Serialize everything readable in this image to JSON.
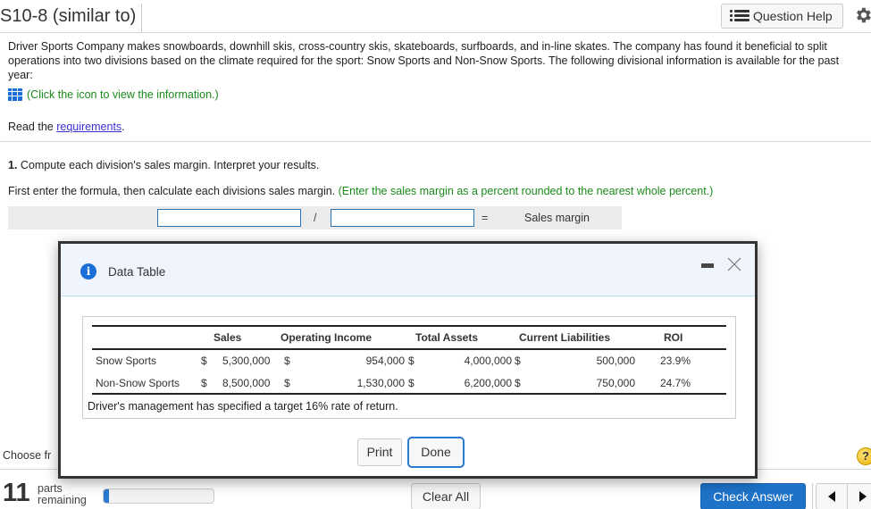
{
  "header": {
    "title": "S10-8 (similar to)",
    "question_help_label": "Question Help"
  },
  "problem": {
    "intro": "Driver Sports Company makes snowboards, downhill skis, cross-country skis, skateboards, surfboards, and in-line skates. The company has found it beneficial to split operations into two divisions based on the climate required for the sport: Snow Sports and Non-Snow Sports. The following divisional information is available for the past year:",
    "info_link": "(Click the icon to view the information.)",
    "read_prefix": "Read the ",
    "requirements_link": "requirements",
    "read_suffix": "."
  },
  "question": {
    "number": "1.",
    "text": " Compute each division's sales margin. Interpret your results.",
    "instruction": "First enter the formula, then calculate each divisions sales margin. ",
    "instruction_hint": "(Enter the sales margin as a percent rounded to the nearest whole percent.)",
    "formula": {
      "input1_value": "",
      "operator": "/",
      "input2_value": "",
      "equals": "=",
      "result_label": "Sales margin"
    },
    "choose_text": "Choose fr"
  },
  "modal": {
    "title": "Data Table",
    "table": {
      "headers": [
        "",
        "Sales",
        "Operating Income",
        "Total Assets",
        "Current Liabilities",
        "ROI"
      ],
      "rows": [
        {
          "division": "Snow Sports",
          "sales_cur": "$",
          "sales": "5,300,000",
          "oi_cur": "$",
          "operating_income": "954,000",
          "ta_cur": "$",
          "total_assets": "4,000,000",
          "cl_cur": "$",
          "current_liabilities": "500,000",
          "roi": "23.9%"
        },
        {
          "division": "Non-Snow Sports",
          "sales_cur": "$",
          "sales": "8,500,000",
          "oi_cur": "$",
          "operating_income": "1,530,000",
          "ta_cur": "$",
          "total_assets": "6,200,000",
          "cl_cur": "$",
          "current_liabilities": "750,000",
          "roi": "24.7%"
        }
      ]
    },
    "note": "Driver's management has specified a target 16% rate of return.",
    "print_label": "Print",
    "done_label": "Done"
  },
  "footer": {
    "parts_count": "11",
    "parts_label_1": "parts",
    "parts_label_2": "remaining",
    "progress_fraction": 0.05,
    "clear_all_label": "Clear All",
    "check_answer_label": "Check Answer",
    "help_glyph": "?"
  }
}
